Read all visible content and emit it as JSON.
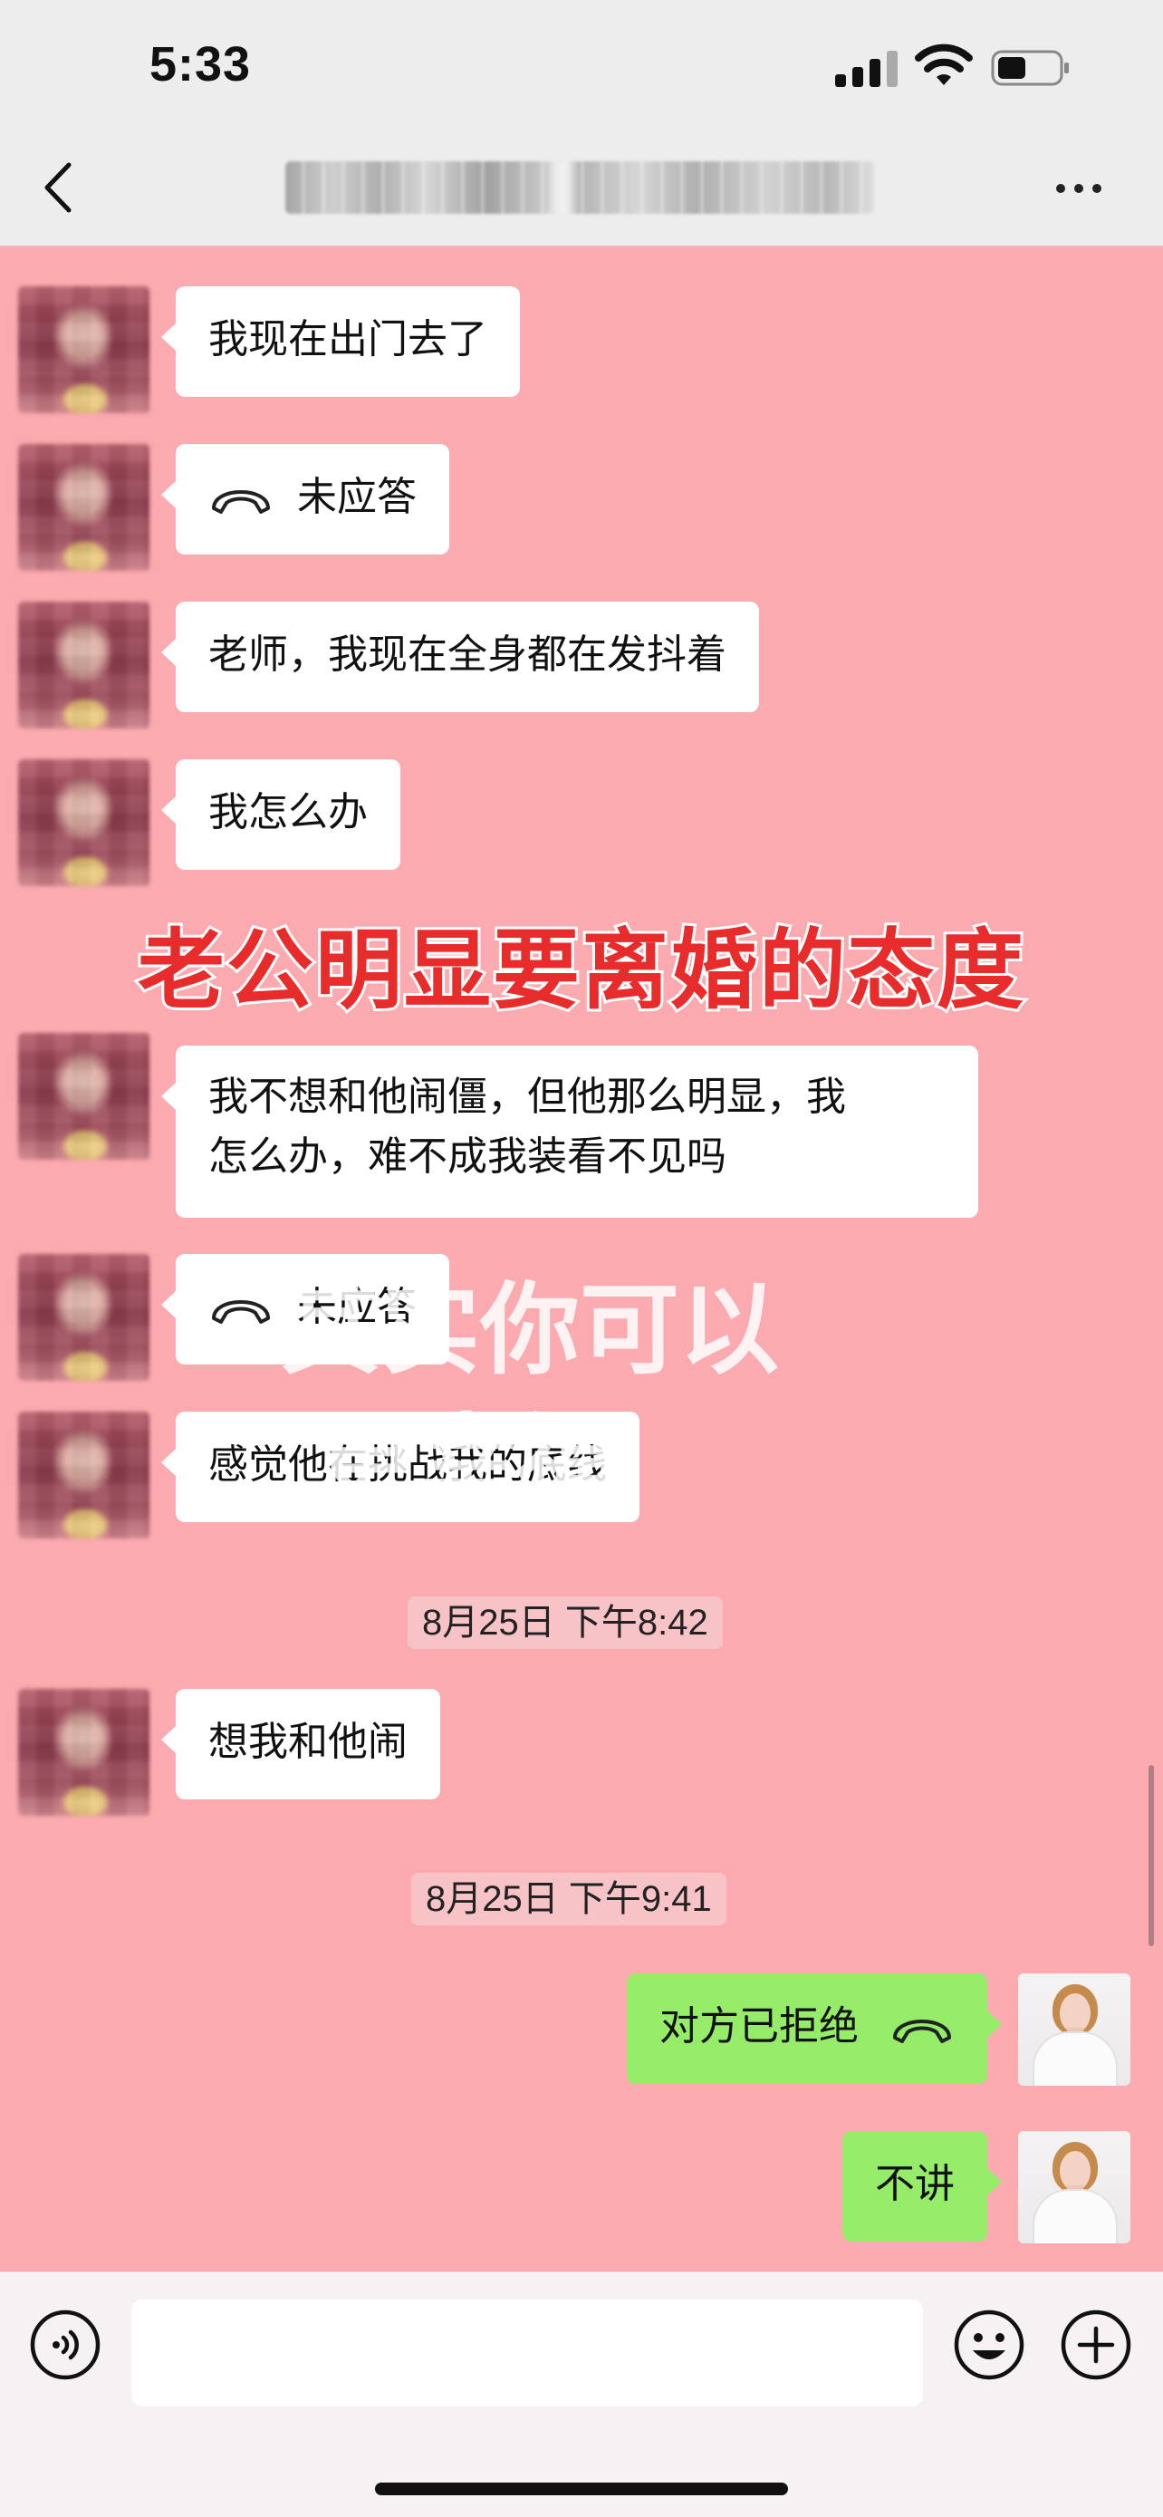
{
  "status_bar": {
    "time": "5:33"
  },
  "nav": {
    "back_icon": "chevron-left-icon",
    "more_icon": "more-dots-icon"
  },
  "overlay": {
    "headline": "老公明显要离婚的态度",
    "watermark_line1": "其实你可以",
    "watermark_line2": "更幸福"
  },
  "messages": [
    {
      "side": "left",
      "text": "我现在出门去了"
    },
    {
      "side": "left",
      "type": "call",
      "text": "未应答"
    },
    {
      "side": "left",
      "text": "老师，我现在全身都在发抖着"
    },
    {
      "side": "left",
      "text": "我怎么办"
    },
    {
      "side": "left",
      "line1": "我不想和他闹僵，但他那么明显，我",
      "line2": "怎么办，难不成我装看不见吗"
    },
    {
      "side": "left",
      "type": "call",
      "text": "未应答"
    },
    {
      "side": "left",
      "text": "感觉他在挑战我的底线"
    },
    {
      "type": "timestamp",
      "text": "8月25日 下午8:42"
    },
    {
      "side": "left",
      "text": "想我和他闹"
    },
    {
      "type": "timestamp",
      "text": "8月25日 下午9:41"
    },
    {
      "side": "right",
      "type": "call",
      "text": "对方已拒绝"
    },
    {
      "side": "right",
      "text": "不讲"
    }
  ],
  "input_bar": {
    "voice_icon": "voice-icon",
    "emoji_icon": "emoji-icon",
    "plus_icon": "plus-icon"
  },
  "colors": {
    "chat_bg": "#fbaaaf",
    "bubble_left": "#ffffff",
    "bubble_right": "#95ec69",
    "headline": "#e82b2b"
  }
}
